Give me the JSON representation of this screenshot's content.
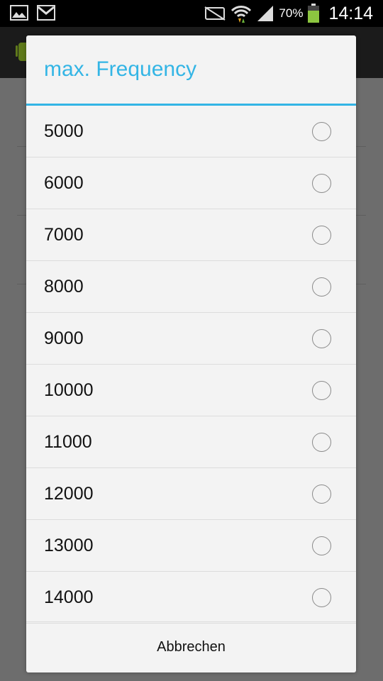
{
  "status_bar": {
    "left_icons": [
      "image-icon",
      "gmail-icon"
    ],
    "right_icons": [
      "nfc-off-icon",
      "wifi-icon",
      "signal-icon",
      "battery-icon"
    ],
    "battery_percent": "70%",
    "time": "14:14",
    "battery_color": "#8cc540"
  },
  "dialog": {
    "title": "max. Frequency",
    "accent_color": "#33b5e5",
    "options": [
      {
        "label": "5000"
      },
      {
        "label": "6000"
      },
      {
        "label": "7000"
      },
      {
        "label": "8000"
      },
      {
        "label": "9000"
      },
      {
        "label": "10000"
      },
      {
        "label": "11000"
      },
      {
        "label": "12000"
      },
      {
        "label": "13000"
      },
      {
        "label": "14000"
      }
    ],
    "cancel_label": "Abbrechen"
  }
}
